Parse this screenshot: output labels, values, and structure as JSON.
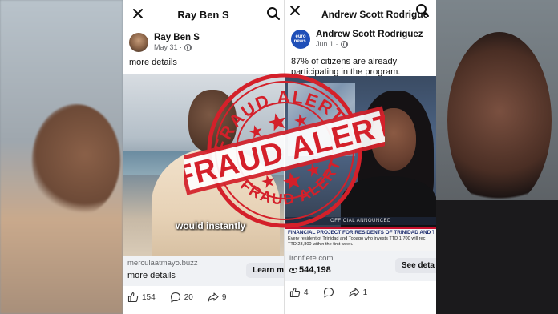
{
  "left_post": {
    "header_title": "Ray Ben S",
    "author_name": "Ray Ben S",
    "date": "May 31 ·",
    "caption": "more details",
    "video_subtitle": "would instantly",
    "link_domain": "merculaatmayo.buzz",
    "link_headline": "more details",
    "cta_label": "Learn m",
    "likes": "154",
    "comments": "20",
    "shares": "9"
  },
  "right_post": {
    "header_title": "Andrew Scott Rodrigue",
    "author_name": "Andrew Scott Rodriguez",
    "avatar_text": "euro news.",
    "date": "Jun 1 ·",
    "caption": "87% of citizens are already participating in the program.",
    "ticker_small": "OFFICIAL ANNOUNCED",
    "ticker_title": "FINANCIAL PROJECT FOR RESIDENTS OF TRINIDAD AND TOBAG",
    "ticker_line1": "Every resident of Trinidad and Tobago who invests TTD 1,700 will rec",
    "ticker_line2": "TTD 23,800 within the first week.",
    "link_domain": "ironflete.com",
    "views": "544,198",
    "cta_label": "See deta",
    "likes": "4",
    "comments": "",
    "shares": "1"
  },
  "stamp": {
    "top_text": "FRAUD ALERT",
    "main_text": "FRAUD ALERT",
    "bottom_text": "FRAUD ALERT",
    "color": "#d4202a"
  }
}
